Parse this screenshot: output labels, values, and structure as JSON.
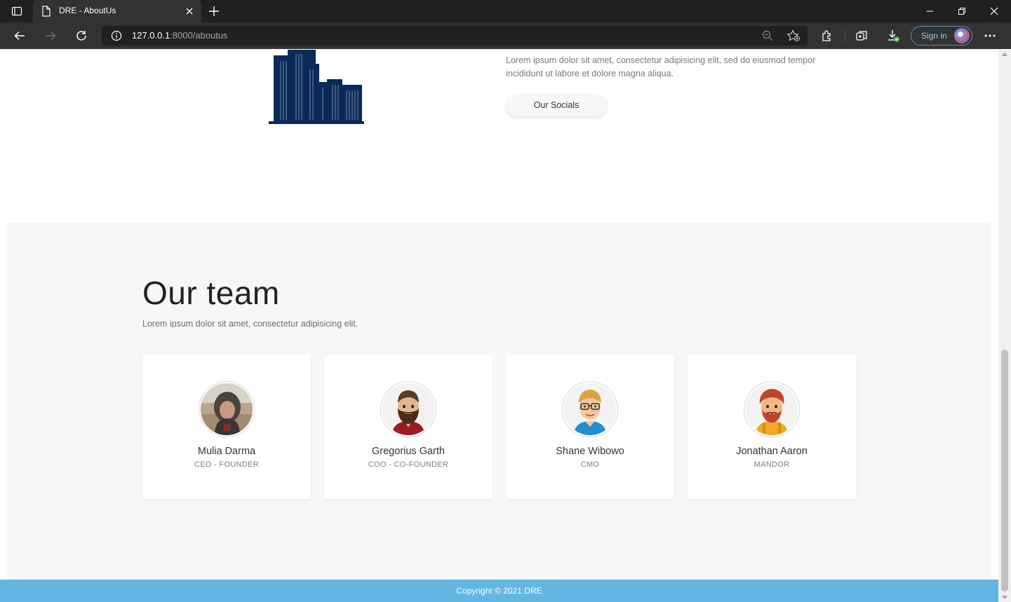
{
  "browser": {
    "tab_title": "DRE - AboutUs",
    "url_host": "127.0.0.1",
    "url_rest": ":8000/aboutus",
    "sign_in_label": "Sign in"
  },
  "about": {
    "paragraph": "Lorem ipsum dolor sit amet, consectetur adipisicing elit, sed do eiusmod tempor incididunt ut labore et dolore magna aliqua.",
    "socials_button": "Our Socials"
  },
  "team": {
    "heading": "Our team",
    "subtitle": "Lorem ipsum dolor sit amet, consectetur adipisicing elit.",
    "members": [
      {
        "name": "Mulia Darma",
        "role": "CEO - FOUNDER",
        "avatar": "photo-avatar"
      },
      {
        "name": "Gregorius Garth",
        "role": "COO - CO-FOUNDER",
        "avatar": "bearded-man-avatar"
      },
      {
        "name": "Shane Wibowo",
        "role": "CMO",
        "avatar": "glasses-man-avatar"
      },
      {
        "name": "Jonathan Aaron",
        "role": "MANDOR",
        "avatar": "redhead-man-avatar"
      }
    ]
  },
  "footer": {
    "copyright": "Copyright © 2021 DRE"
  },
  "colors": {
    "footer_bg": "#63b6e1",
    "section_bg": "#f6f7f9",
    "building": "#0b2a5a"
  }
}
